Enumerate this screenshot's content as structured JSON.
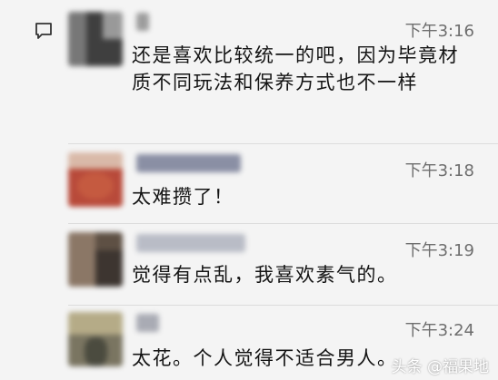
{
  "messages": [
    {
      "time": "下午3:16",
      "text": "还是喜欢比较统一的吧，因为毕竟材质不同玩法和保养方式也不一样"
    },
    {
      "time": "下午3:18",
      "text": "太难攒了！"
    },
    {
      "time": "下午3:19",
      "text": "觉得有点乱，我喜欢素气的。"
    },
    {
      "time": "下午3:24",
      "text": "太花。个人觉得不适合男人。"
    }
  ],
  "watermark": "头条 @福果地",
  "icons": {
    "comment": "comment-icon"
  },
  "colors": {
    "background": "#f4f4f4",
    "time": "#6e6e6e",
    "text": "#141414"
  }
}
